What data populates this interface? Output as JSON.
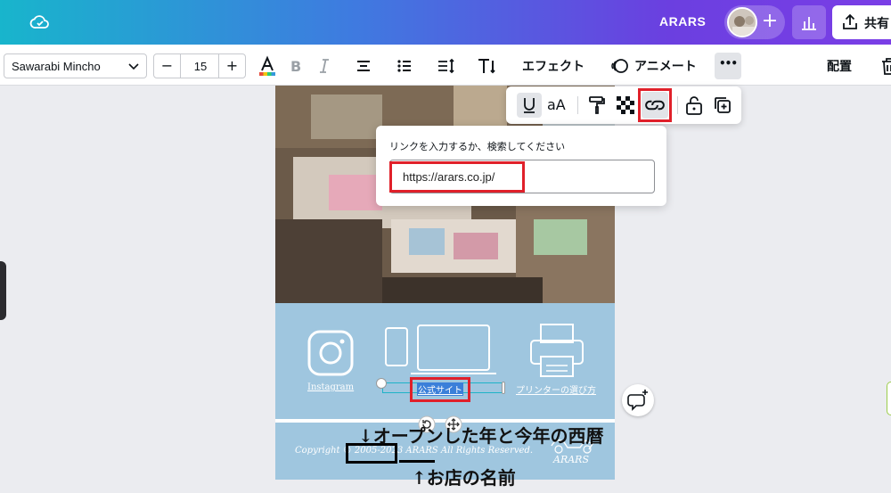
{
  "header": {
    "title": "ARARS",
    "share_label": "共有",
    "colors": {
      "gradient_start": "#18b5cc",
      "gradient_end": "#7a3ee6"
    }
  },
  "toolbar": {
    "font_family_value": "Sawarabi Mincho",
    "font_size_value": "15",
    "size_minus": "−",
    "size_plus": "+",
    "effect_label": "エフェクト",
    "animate_label": "アニメート",
    "position_label": "配置",
    "more_label": "•••"
  },
  "floating_toolbar": {
    "aa_label": "aA"
  },
  "link_popover": {
    "label": "リンクを入力するか、検索してください",
    "url_value": "https://arars.co.jp/"
  },
  "design": {
    "instagram_label": "Instagram",
    "site_label": "公式サイト",
    "printer_label": "プリンターの選び方",
    "copyright_text": "Copyright © 2005-2023 ARARS All Rights Reserved.",
    "logo_text": "ARARS"
  },
  "annotations": {
    "years": "↓オープンした年と今年の西暦",
    "shop": "↑お店の名前"
  }
}
